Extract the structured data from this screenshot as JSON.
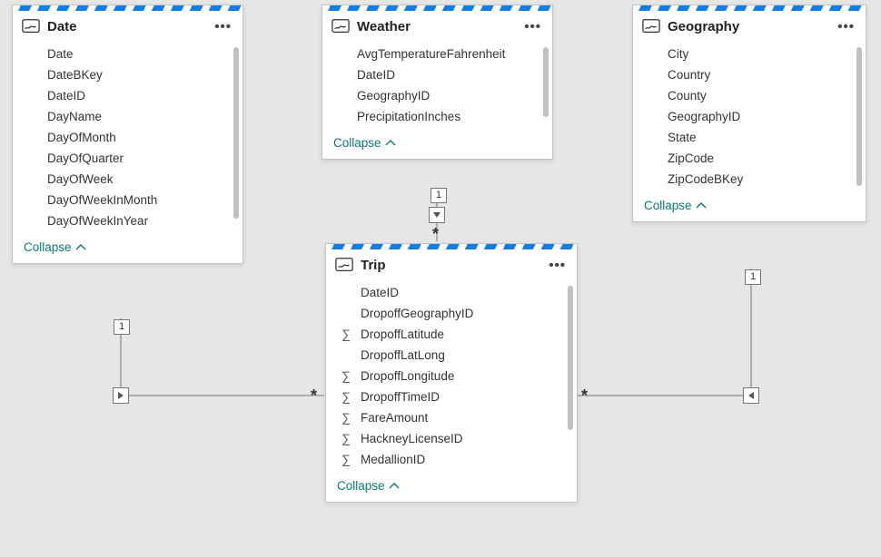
{
  "collapseLabel": "Collapse",
  "tables": {
    "date": {
      "title": "Date",
      "fields": [
        {
          "name": "Date",
          "sum": false
        },
        {
          "name": "DateBKey",
          "sum": false
        },
        {
          "name": "DateID",
          "sum": false
        },
        {
          "name": "DayName",
          "sum": false
        },
        {
          "name": "DayOfMonth",
          "sum": false
        },
        {
          "name": "DayOfQuarter",
          "sum": false
        },
        {
          "name": "DayOfWeek",
          "sum": false
        },
        {
          "name": "DayOfWeekInMonth",
          "sum": false
        },
        {
          "name": "DayOfWeekInYear",
          "sum": false
        }
      ]
    },
    "weather": {
      "title": "Weather",
      "fields": [
        {
          "name": "AvgTemperatureFahrenheit",
          "sum": false
        },
        {
          "name": "DateID",
          "sum": false
        },
        {
          "name": "GeographyID",
          "sum": false
        },
        {
          "name": "PrecipitationInches",
          "sum": false
        }
      ]
    },
    "geography": {
      "title": "Geography",
      "fields": [
        {
          "name": "City",
          "sum": false
        },
        {
          "name": "Country",
          "sum": false
        },
        {
          "name": "County",
          "sum": false
        },
        {
          "name": "GeographyID",
          "sum": false
        },
        {
          "name": "State",
          "sum": false
        },
        {
          "name": "ZipCode",
          "sum": false
        },
        {
          "name": "ZipCodeBKey",
          "sum": false
        }
      ]
    },
    "trip": {
      "title": "Trip",
      "fields": [
        {
          "name": "DateID",
          "sum": false
        },
        {
          "name": "DropoffGeographyID",
          "sum": false
        },
        {
          "name": "DropoffLatitude",
          "sum": true
        },
        {
          "name": "DropoffLatLong",
          "sum": false
        },
        {
          "name": "DropoffLongitude",
          "sum": true
        },
        {
          "name": "DropoffTimeID",
          "sum": true
        },
        {
          "name": "FareAmount",
          "sum": true
        },
        {
          "name": "HackneyLicenseID",
          "sum": true
        },
        {
          "name": "MedallionID",
          "sum": true
        }
      ]
    }
  },
  "relationships": {
    "date_to_trip": {
      "from": "Date",
      "to": "Trip",
      "fromCard": "1",
      "toCard": "*"
    },
    "weather_to_trip": {
      "from": "Weather",
      "to": "Trip",
      "fromCard": "1",
      "toCard": "*"
    },
    "geography_to_trip": {
      "from": "Geography",
      "to": "Trip",
      "fromCard": "1",
      "toCard": "*"
    }
  }
}
